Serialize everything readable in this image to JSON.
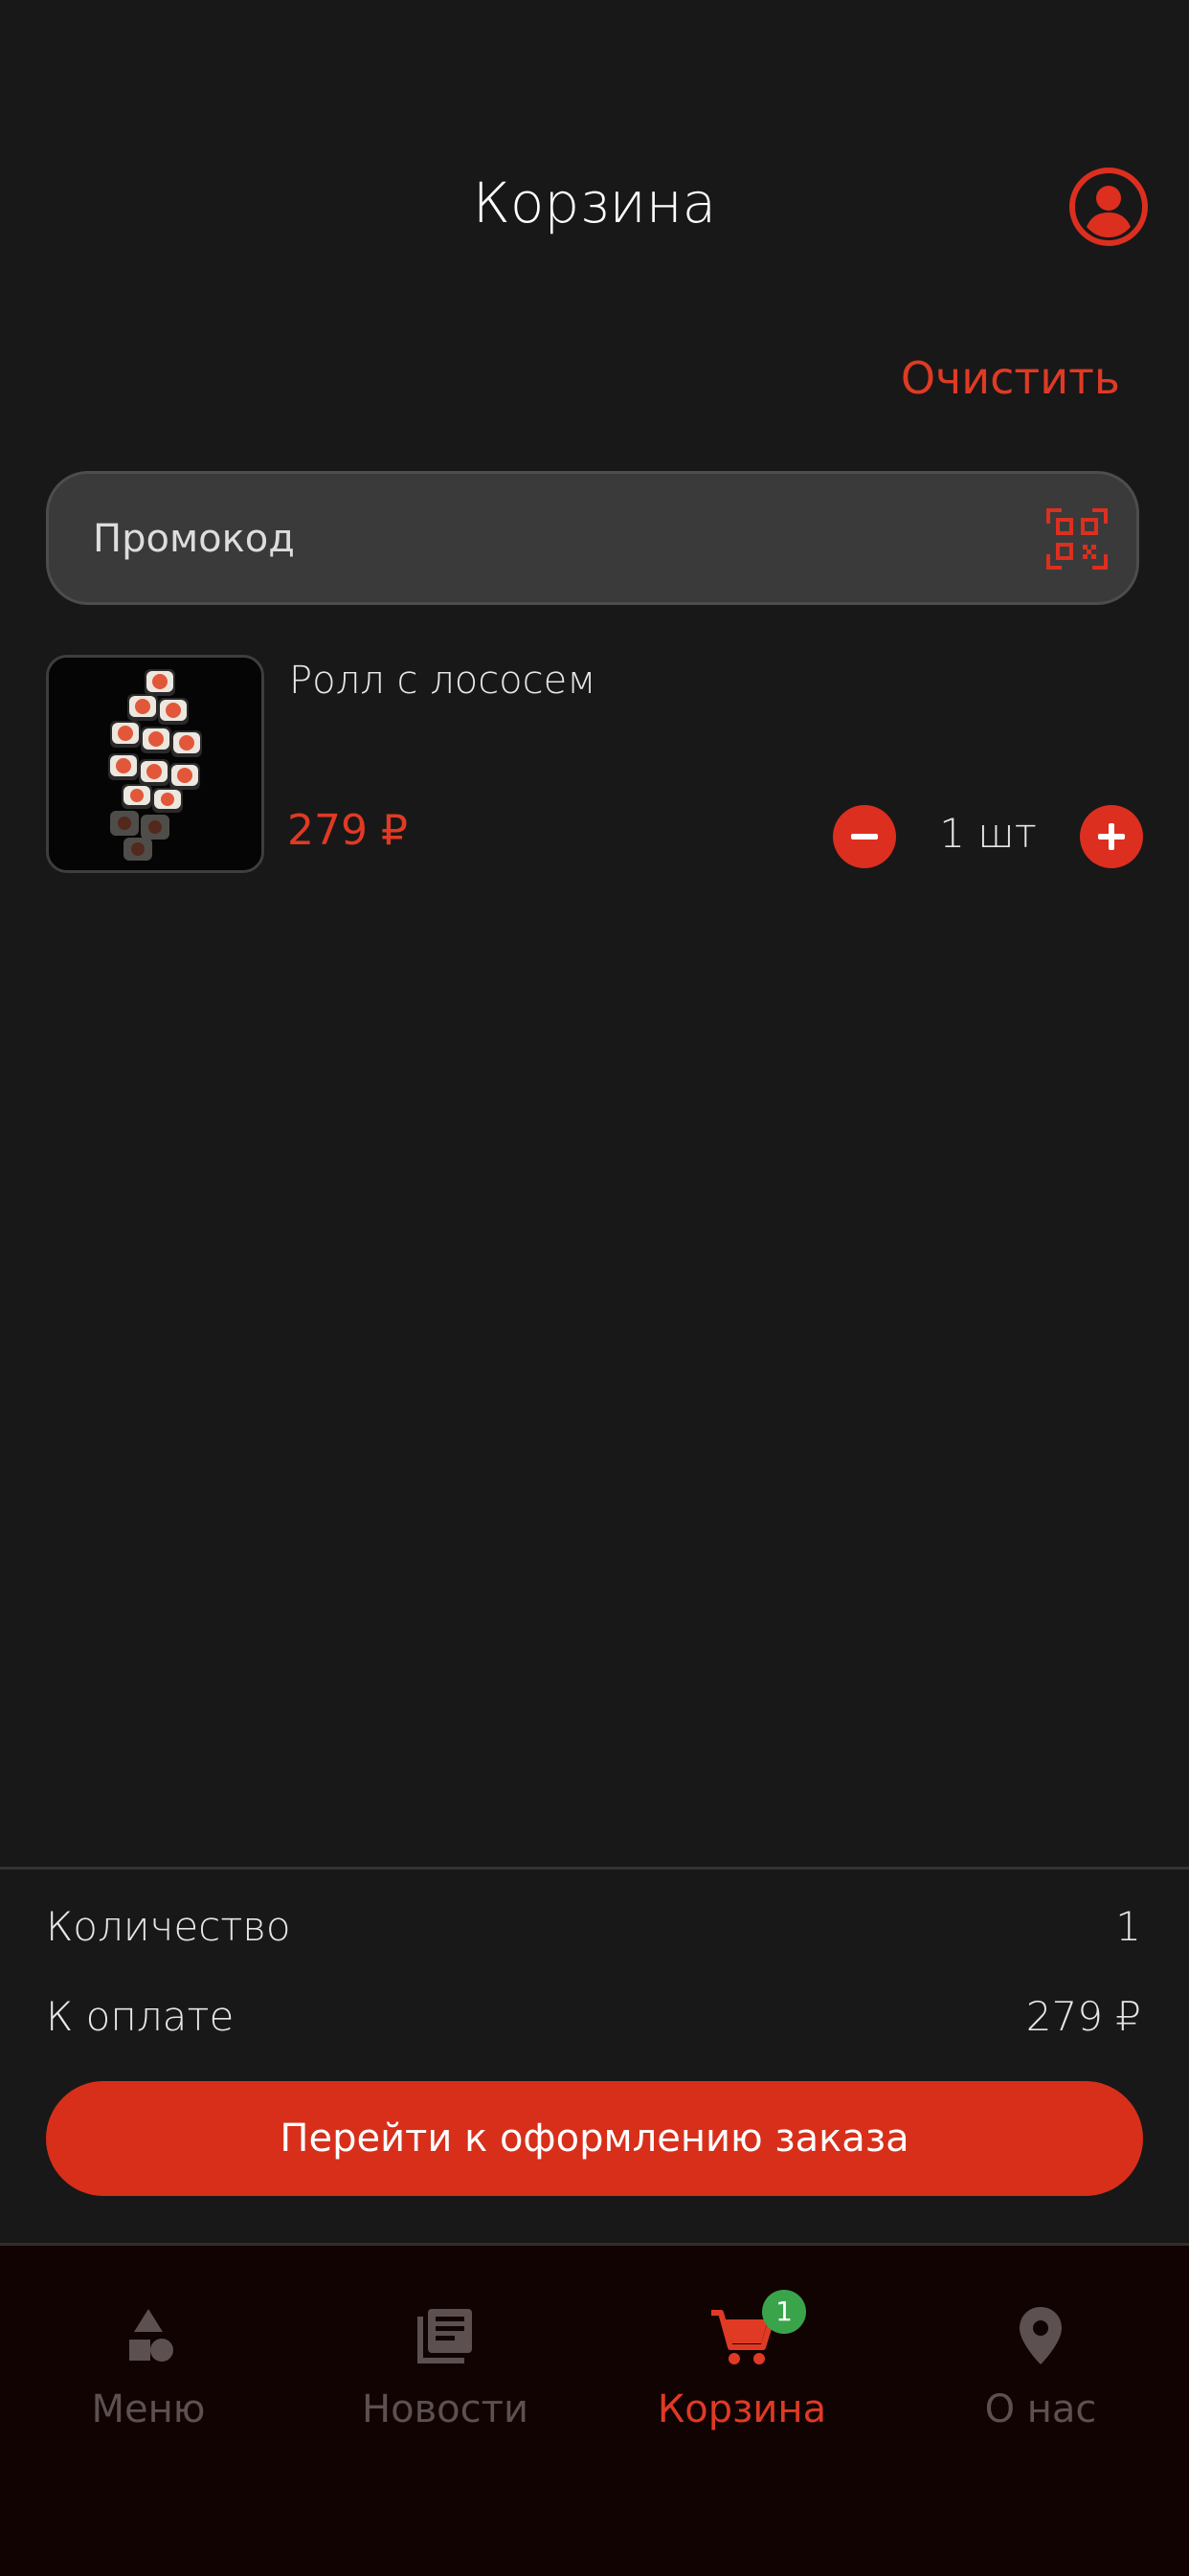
{
  "header": {
    "title": "Корзина",
    "profile_icon": "account-circle-icon"
  },
  "actions": {
    "clear_label": "Очистить"
  },
  "promo": {
    "placeholder": "Промокод",
    "scan_icon": "qr-code-icon"
  },
  "cart": {
    "items": [
      {
        "name": "Ролл с лососем",
        "price": "279 ₽",
        "quantity": "1 шт",
        "image": "salmon-roll-photo"
      }
    ]
  },
  "summary": {
    "count_label": "Количество",
    "count_value": "1",
    "total_label": "К оплате",
    "total_value": "279 ₽",
    "checkout_label": "Перейти к оформлению заказа"
  },
  "tabs": [
    {
      "label": "Меню",
      "icon": "shapes-icon",
      "active": false
    },
    {
      "label": "Новости",
      "icon": "news-icon",
      "active": false
    },
    {
      "label": "Корзина",
      "icon": "cart-icon",
      "active": true,
      "badge": "1"
    },
    {
      "label": "О нас",
      "icon": "location-pin-icon",
      "active": false
    }
  ],
  "colors": {
    "accent": "#dc2f1f",
    "background": "#181818",
    "badge": "#3aa44a",
    "tabbar": "#120303"
  }
}
